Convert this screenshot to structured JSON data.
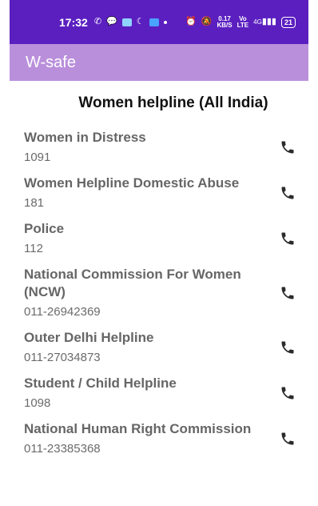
{
  "status_bar": {
    "time": "17:32",
    "speed_value": "0.17",
    "speed_unit": "KB/S",
    "vo": "Vo",
    "lte": "LTE",
    "network": "4G",
    "battery": "21"
  },
  "app_bar": {
    "title": "W-safe"
  },
  "page": {
    "heading": "Women helpline (All India)"
  },
  "helplines": [
    {
      "name": "Women in Distress",
      "number": "1091"
    },
    {
      "name": "Women Helpline Domestic Abuse",
      "number": "181"
    },
    {
      "name": "Police",
      "number": "112"
    },
    {
      "name": "National Commission For Women (NCW)",
      "number": "011-26942369"
    },
    {
      "name": "Outer Delhi Helpline",
      "number": "011-27034873"
    },
    {
      "name": "Student / Child Helpline",
      "number": "1098"
    },
    {
      "name": "National Human Right Commission",
      "number": "011-23385368"
    }
  ],
  "colors": {
    "status_bar": "#5b1fc0",
    "app_bar": "#b98fdb",
    "heading_text": "#111111",
    "item_text": "#666666",
    "call_icon": "#2b2b2b"
  },
  "icons": {
    "call": "phone-icon"
  }
}
